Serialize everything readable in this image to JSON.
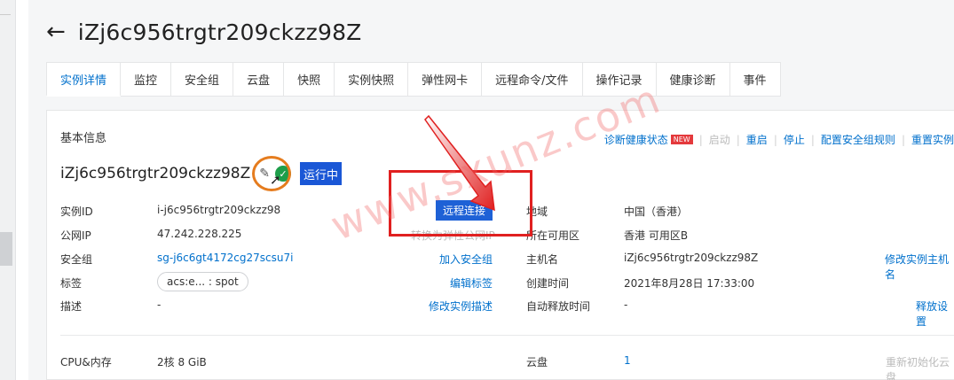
{
  "title": "iZj6c956trgtr209ckzz98Z",
  "tabs": [
    "实例详情",
    "监控",
    "安全组",
    "云盘",
    "快照",
    "实例快照",
    "弹性网卡",
    "远程命令/文件",
    "操作记录",
    "健康诊断",
    "事件"
  ],
  "section_title": "基本信息",
  "actions": {
    "diagnose": "诊断健康状态",
    "new_badge": "NEW",
    "start": "启动",
    "restart": "重启",
    "stop": "停止",
    "sg_rules": "配置安全组规则",
    "reset": "重置实例"
  },
  "instance": {
    "name": "iZj6c956trgtr209ckzz98Z",
    "status": "运行中"
  },
  "left_fields": {
    "id_label": "实例ID",
    "id_value": "i-j6c956trgtr209ckzz98",
    "ip_label": "公网IP",
    "ip_value": "47.242.228.225",
    "sg_label": "安全组",
    "sg_value": "sg-j6c6gt4172cg27scsu7i",
    "tag_label": "标签",
    "tag_value": "acs:e... : spot",
    "desc_label": "描述",
    "desc_value": "-"
  },
  "mid_links": {
    "remote": "远程连接",
    "convert_eip": "转换为弹性公网IP",
    "join_sg": "加入安全组",
    "edit_tag": "编辑标签",
    "edit_desc": "修改实例描述"
  },
  "right_fields": {
    "region_label": "地域",
    "region_value": "中国（香港）",
    "zone_label": "所在可用区",
    "zone_value": "香港 可用区B",
    "host_label": "主机名",
    "host_value": "iZj6c956trgtr209ckzz98Z",
    "created_label": "创建时间",
    "created_value": "2021年8月28日 17:33:00",
    "release_label": "自动释放时间",
    "release_value": "-"
  },
  "right_links": {
    "edit_host": "修改实例主机名",
    "release_setting": "释放设置"
  },
  "bottom": {
    "cpu_label": "CPU&内存",
    "cpu_value": "2核 8 GiB",
    "disk_label": "云盘",
    "disk_value": "1",
    "reinit": "重新初始化云盘"
  },
  "watermark": "www.sxunz.com",
  "colors": {
    "accent": "#0070cc",
    "status": "#1a57d6",
    "highlight": "#e02020",
    "ring": "#e57c1e"
  }
}
